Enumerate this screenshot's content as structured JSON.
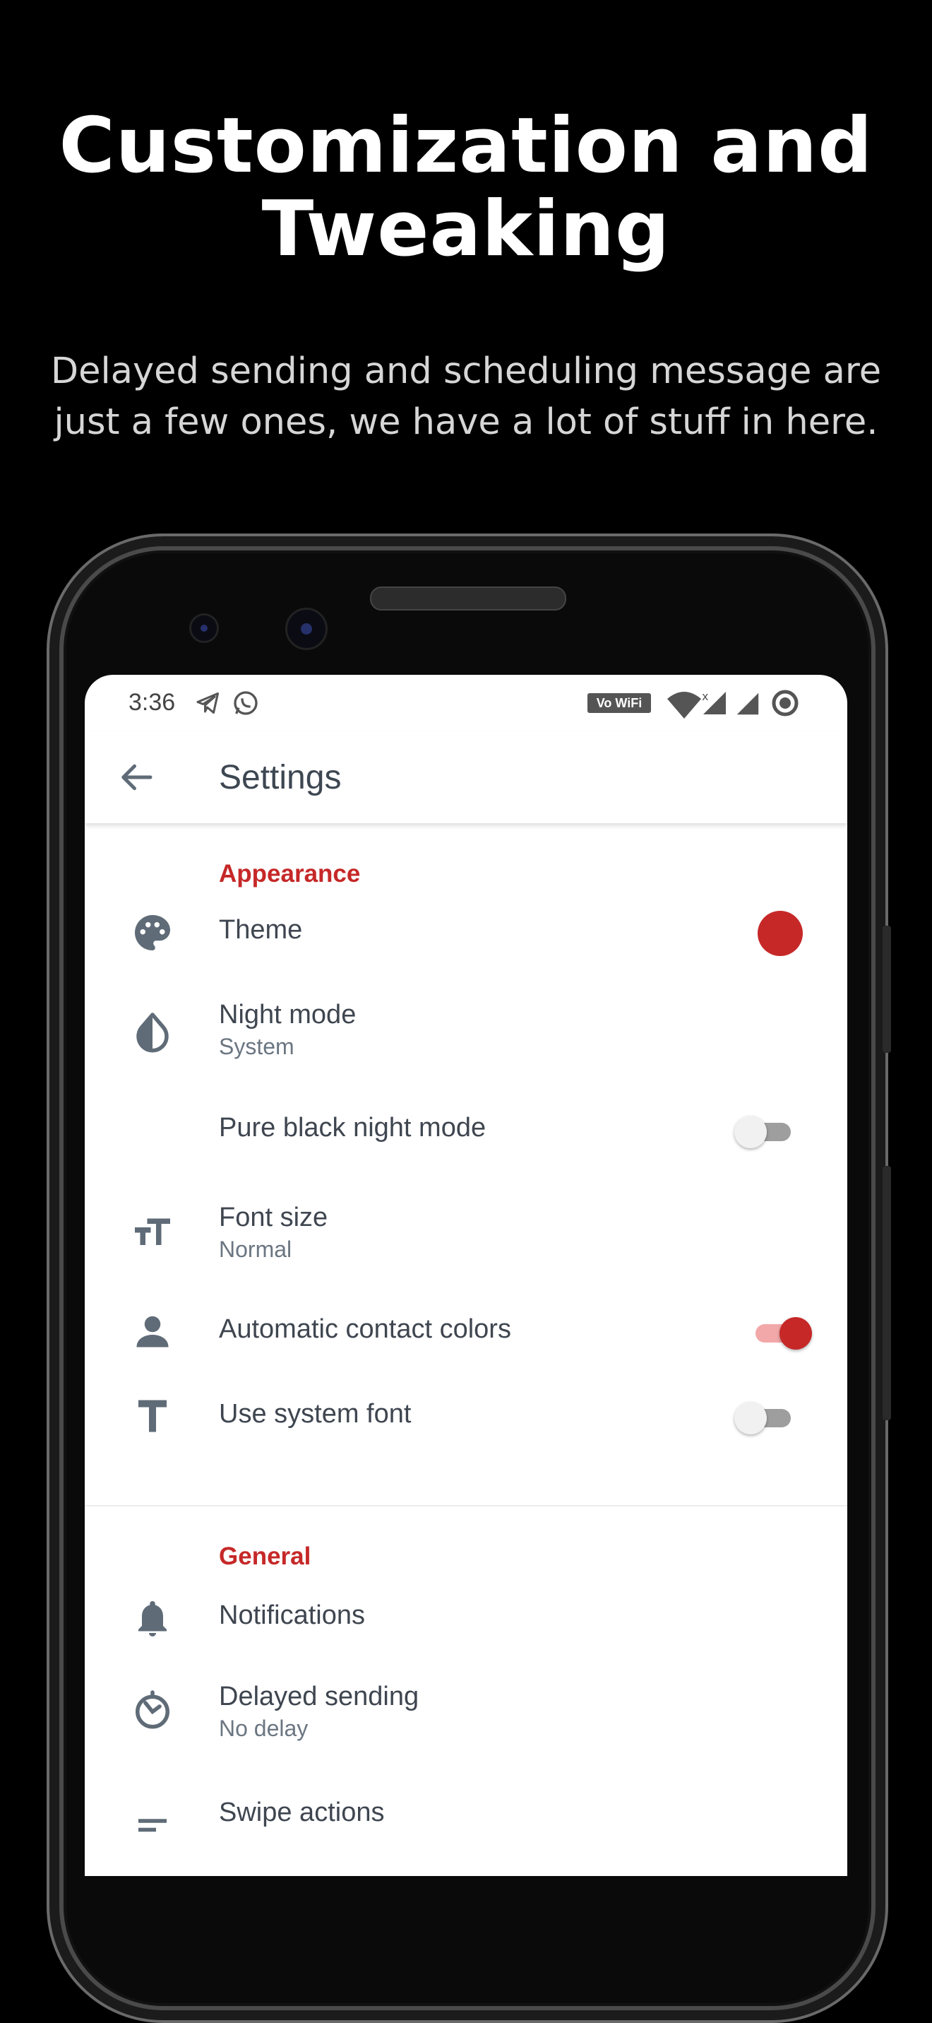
{
  "promo": {
    "headline_line1": "Customization and",
    "headline_line2": "Tweaking",
    "subhead_line1": "Delayed sending and scheduling message are",
    "subhead_line2": "just a few ones, we have a lot of stuff in here."
  },
  "status_bar": {
    "time": "3:36",
    "vowifi_label": "Vo WiFi",
    "icons": [
      "telegram-icon",
      "whatsapp-icon",
      "wifi-icon",
      "signal-icon",
      "signal-icon",
      "circle-status-icon"
    ]
  },
  "app_bar": {
    "title": "Settings"
  },
  "sections": {
    "appearance": "Appearance",
    "general": "General"
  },
  "settings": {
    "theme": {
      "label": "Theme",
      "color": "#c62828"
    },
    "night_mode": {
      "label": "Night mode",
      "value": "System"
    },
    "pure_black": {
      "label": "Pure black night mode",
      "enabled": false
    },
    "font_size": {
      "label": "Font size",
      "value": "Normal"
    },
    "auto_contact_colors": {
      "label": "Automatic contact colors",
      "enabled": true
    },
    "system_font": {
      "label": "Use system font",
      "enabled": false
    },
    "notifications": {
      "label": "Notifications"
    },
    "delayed_sending": {
      "label": "Delayed sending",
      "value": "No delay"
    },
    "swipe_actions": {
      "label": "Swipe actions"
    }
  },
  "colors": {
    "accent": "#c62828",
    "text_primary": "#3f4650",
    "text_secondary": "#6b7682",
    "icon": "#5f6b77"
  }
}
